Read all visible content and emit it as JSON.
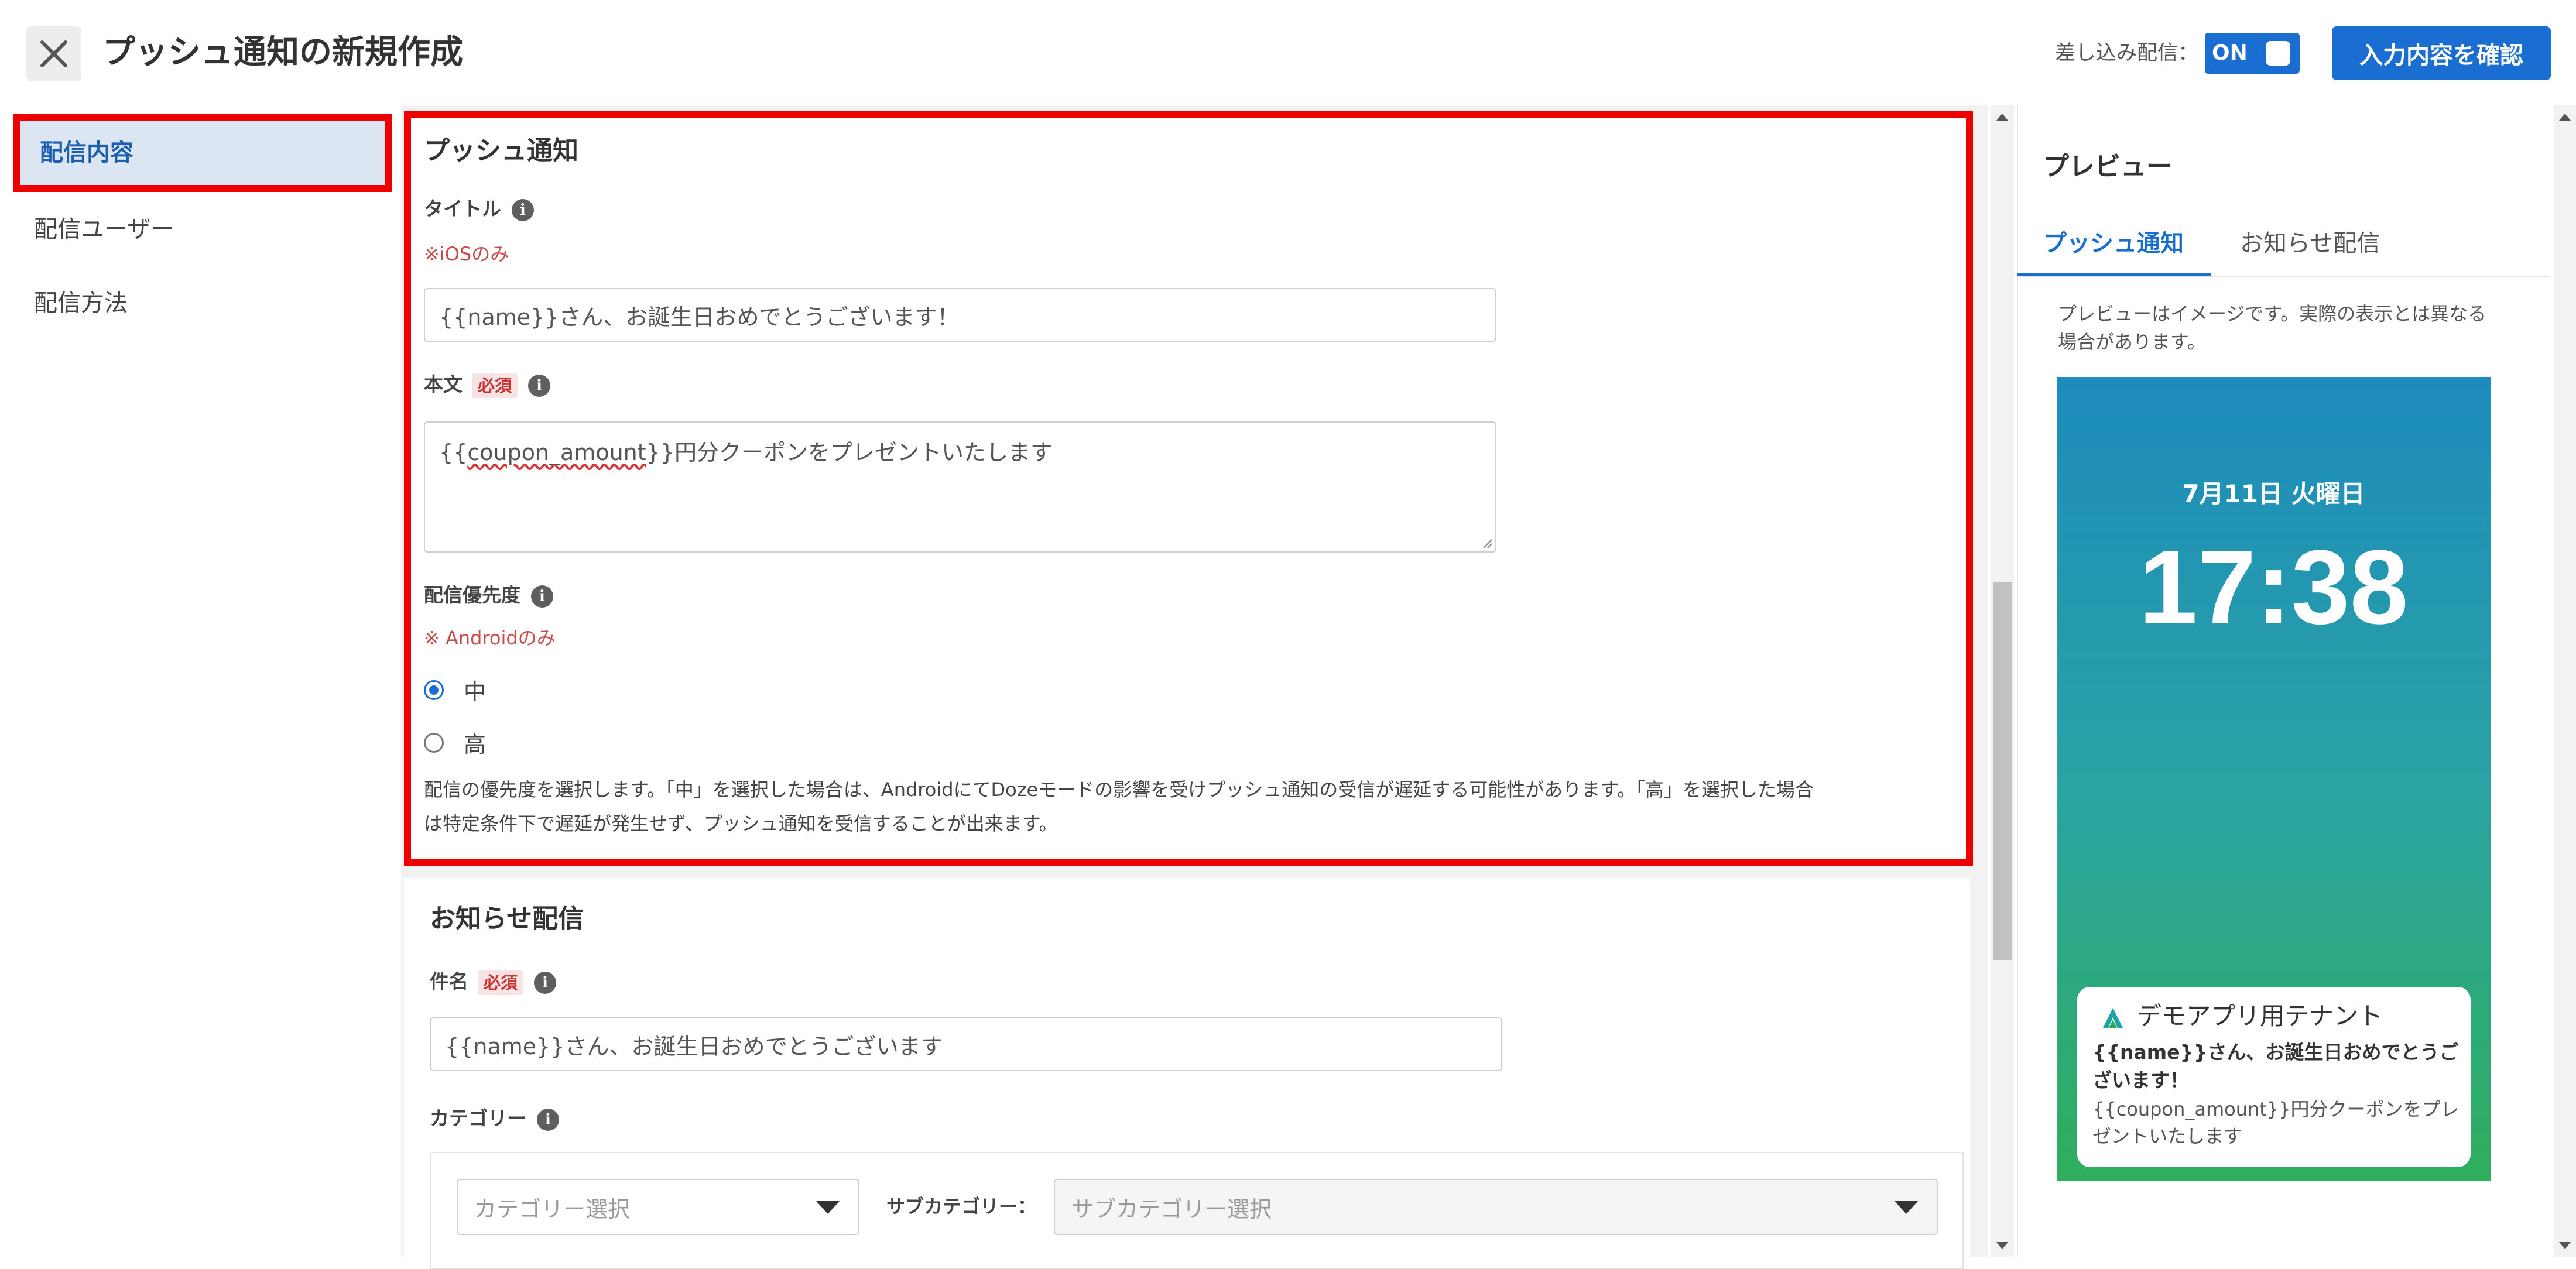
{
  "header": {
    "title": "プッシュ通知の新規作成",
    "sashikomi_label": "差し込み配信：",
    "toggle_label": "ON",
    "confirm_button": "入力内容を確認"
  },
  "sidebar": {
    "items": [
      {
        "label": "配信内容",
        "active": true
      },
      {
        "label": "配信ユーザー",
        "active": false
      },
      {
        "label": "配信方法",
        "active": false
      }
    ]
  },
  "push": {
    "section_title": "プッシュ通知",
    "title_label": "タイトル",
    "title_note": "※iOSのみ",
    "title_value": "{{name}}さん、お誕生日おめでとうございます！",
    "body_label": "本文",
    "required": "必須",
    "body_value_prefix": "{{",
    "body_value_var": "coupon_amount",
    "body_value_suffix": "}}円分クーポンをプレゼントいたします",
    "priority_label": "配信優先度",
    "priority_note": "※ Androidのみ",
    "priority_options": [
      {
        "label": "中",
        "checked": true
      },
      {
        "label": "高",
        "checked": false
      }
    ],
    "description_line1": "配信の優先度を選択します。「中」を選択した場合は、AndroidにてDozeモードの影響を受けプッシュ通知の受信が遅延する可能性があります。「高」を選択した場合",
    "description_line2": "は特定条件下で遅延が発生せず、プッシュ通知を受信することが出来ます。"
  },
  "news": {
    "section_title": "お知らせ配信",
    "subject_label": "件名",
    "required": "必須",
    "subject_value": "{{name}}さん、お誕生日おめでとうございます",
    "category_label": "カテゴリー",
    "category_placeholder": "カテゴリー選択",
    "subcategory_label": "サブカテゴリー：",
    "subcategory_placeholder": "サブカテゴリー選択"
  },
  "preview": {
    "title": "プレビュー",
    "tabs": [
      {
        "label": "プッシュ通知",
        "active": true
      },
      {
        "label": "お知らせ配信",
        "active": false
      }
    ],
    "note": "プレビューはイメージです。実際の表示とは異なる場合があります。",
    "date": "7月11日 火曜日",
    "time": "17:38",
    "app_name": "デモアプリ用テナント",
    "notif_title": "{{name}}さん、お誕生日おめでとうございます！",
    "notif_body": "{{coupon_amount}}円分クーポンをプレゼントいたします"
  },
  "colors": {
    "accent": "#1a6ed2",
    "highlight_border": "#ee0000",
    "required_text": "#cc3333",
    "gradient_top": "#1d8bbd",
    "gradient_bottom": "#2fae5c"
  }
}
